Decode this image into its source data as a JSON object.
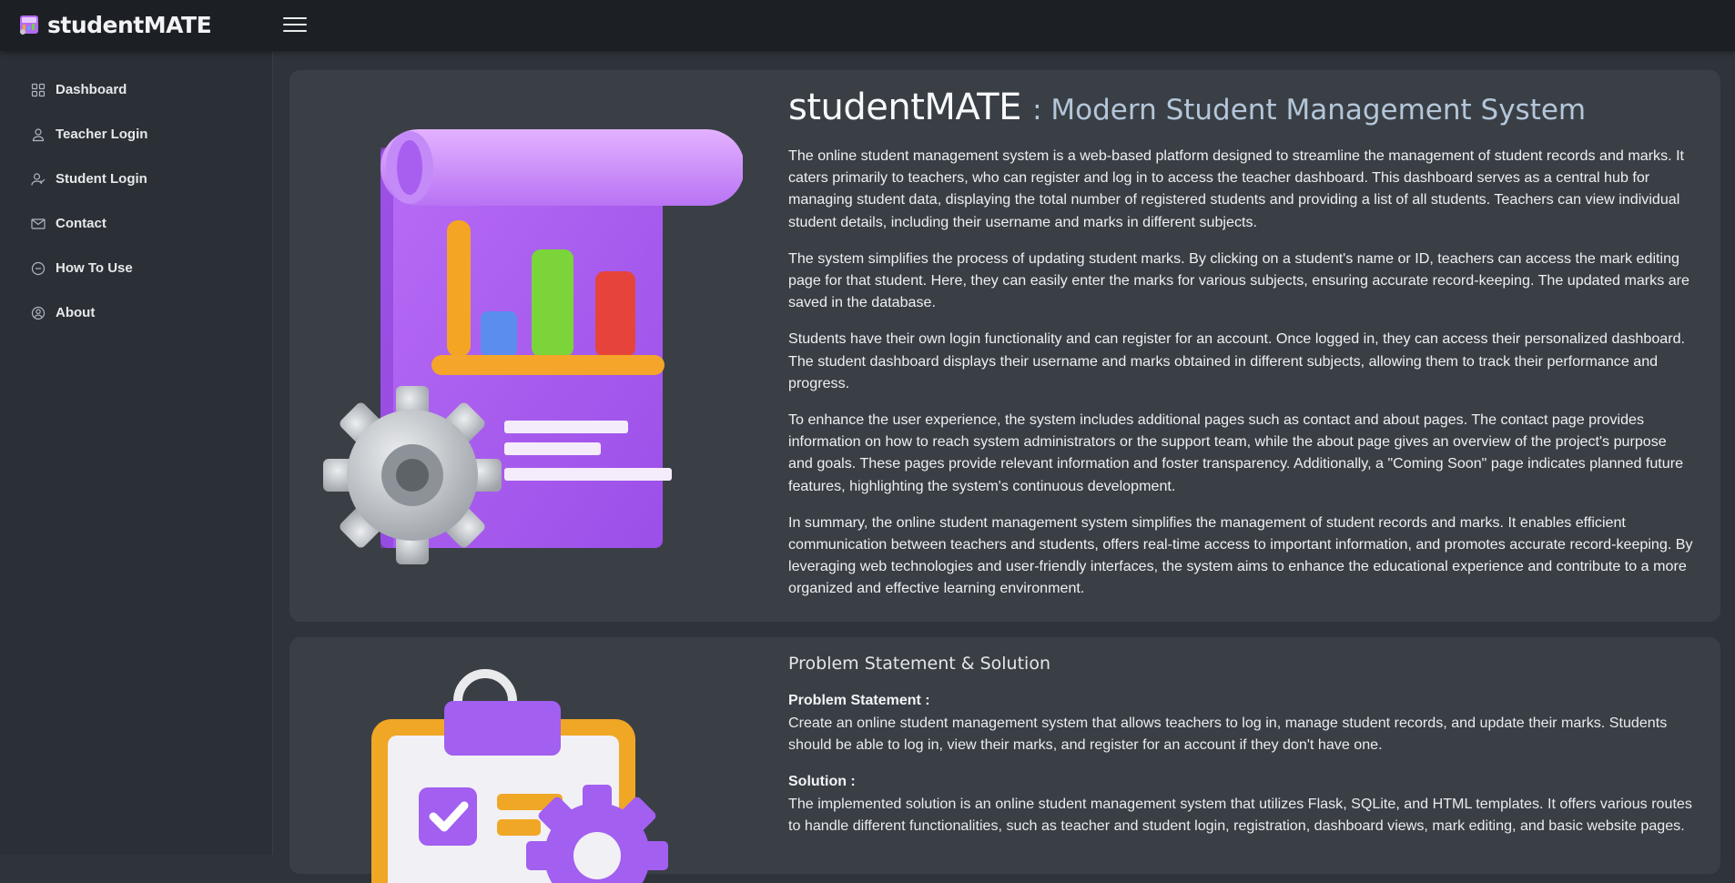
{
  "app": {
    "brand": "studentMATE"
  },
  "sidebar": {
    "items": [
      {
        "label": "Dashboard",
        "icon": "grid-icon"
      },
      {
        "label": "Teacher Login",
        "icon": "person-icon"
      },
      {
        "label": "Student Login",
        "icon": "person-check-icon"
      },
      {
        "label": "Contact",
        "icon": "envelope-icon"
      },
      {
        "label": "How To Use",
        "icon": "dash-circle-icon"
      },
      {
        "label": "About",
        "icon": "person-circle-icon"
      }
    ]
  },
  "intro": {
    "title": "studentMATE",
    "subtitle": ": Modern Student Management System",
    "paragraphs": [
      "The online student management system is a web-based platform designed to streamline the management of student records and marks. It caters primarily to teachers, who can register and log in to access the teacher dashboard. This dashboard serves as a central hub for managing student data, displaying the total number of registered students and providing a list of all students. Teachers can view individual student details, including their username and marks in different subjects.",
      "The system simplifies the process of updating student marks. By clicking on a student's name or ID, teachers can access the mark editing page for that student. Here, they can easily enter the marks for various subjects, ensuring accurate record-keeping. The updated marks are saved in the database.",
      "Students have their own login functionality and can register for an account. Once logged in, they can access their personalized dashboard. The student dashboard displays their username and marks obtained in different subjects, allowing them to track their performance and progress.",
      "To enhance the user experience, the system includes additional pages such as contact and about pages. The contact page provides information on how to reach system administrators or the support team, while the about page gives an overview of the project's purpose and goals. These pages provide relevant information and foster transparency. Additionally, a \"Coming Soon\" page indicates planned future features, highlighting the system's continuous development.",
      "In summary, the online student management system simplifies the management of student records and marks. It enables efficient communication between teachers and students, offers real-time access to important information, and promotes accurate record-keeping. By leveraging web technologies and user-friendly interfaces, the system aims to enhance the educational experience and contribute to a more organized and effective learning environment."
    ]
  },
  "problem": {
    "title": "Problem Statement & Solution",
    "problem_label": "Problem Statement :",
    "problem_text": "Create an online student management system that allows teachers to log in, manage student records, and update their marks. Students should be able to log in, view their marks, and register for an account if they don't have one.",
    "solution_label": "Solution :",
    "solution_text": "The implemented solution is an online student management system that utilizes Flask, SQLite, and HTML templates. It offers various routes to handle different functionalities, such as teacher and student login, registration, dashboard views, mark editing, and basic website pages."
  },
  "colors": {
    "topbar": "#1c1f23",
    "sidebar": "#2b3036",
    "background": "#2f343b",
    "card": "#3a3f46",
    "subtitle": "#b4c6d9",
    "accent_purple": "#a855f7",
    "accent_orange": "#f5a524"
  }
}
